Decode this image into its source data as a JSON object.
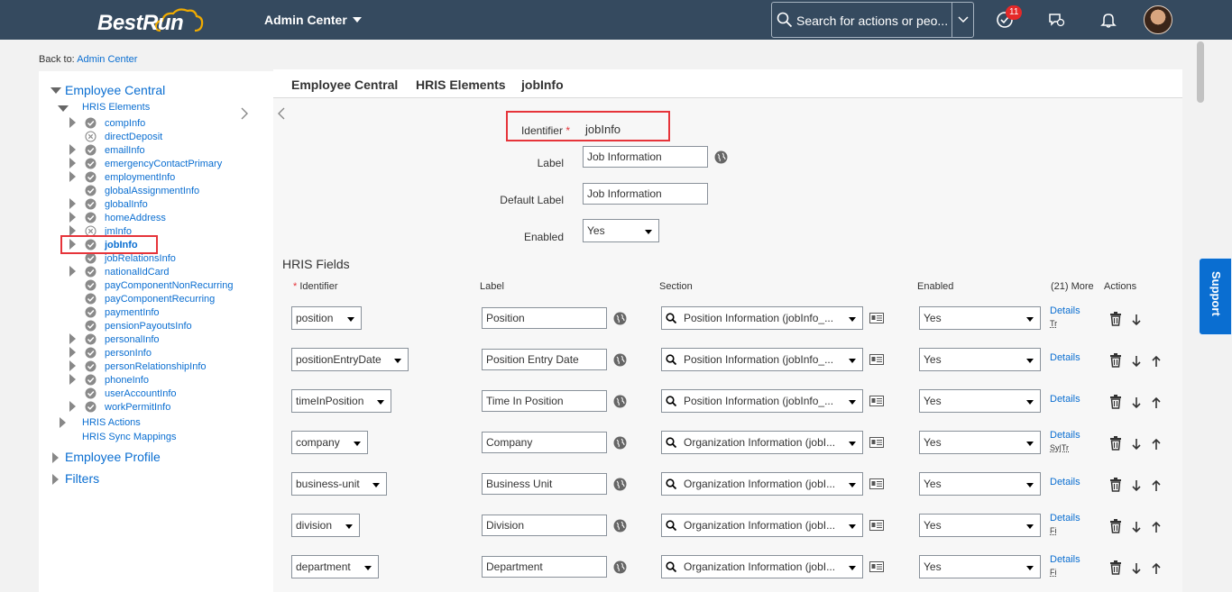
{
  "header": {
    "logo_text": "BestRun",
    "module": "Admin Center",
    "search_placeholder": "Search for actions or peo...",
    "notification_count": "11"
  },
  "back": {
    "prefix": "Back to:",
    "link": "Admin Center"
  },
  "tree": {
    "root": "Employee Central",
    "hris_elements": "HRIS Elements",
    "items": [
      {
        "label": "compInfo",
        "expand": true,
        "status": "check"
      },
      {
        "label": "directDeposit",
        "expand": false,
        "status": "x"
      },
      {
        "label": "emailInfo",
        "expand": true,
        "status": "check"
      },
      {
        "label": "emergencyContactPrimary",
        "expand": true,
        "status": "check"
      },
      {
        "label": "employmentInfo",
        "expand": true,
        "status": "check"
      },
      {
        "label": "globalAssignmentInfo",
        "expand": false,
        "status": "check"
      },
      {
        "label": "globalInfo",
        "expand": true,
        "status": "check"
      },
      {
        "label": "homeAddress",
        "expand": true,
        "status": "check"
      },
      {
        "label": "jmInfo",
        "expand": true,
        "status": "x"
      },
      {
        "label": "jobInfo",
        "expand": true,
        "status": "check"
      },
      {
        "label": "jobRelationsInfo",
        "expand": false,
        "status": "check"
      },
      {
        "label": "nationalIdCard",
        "expand": true,
        "status": "check"
      },
      {
        "label": "payComponentNonRecurring",
        "expand": false,
        "status": "check"
      },
      {
        "label": "payComponentRecurring",
        "expand": false,
        "status": "check"
      },
      {
        "label": "paymentInfo",
        "expand": false,
        "status": "check"
      },
      {
        "label": "pensionPayoutsInfo",
        "expand": false,
        "status": "check"
      },
      {
        "label": "personalInfo",
        "expand": true,
        "status": "check"
      },
      {
        "label": "personInfo",
        "expand": true,
        "status": "check"
      },
      {
        "label": "personRelationshipInfo",
        "expand": true,
        "status": "check"
      },
      {
        "label": "phoneInfo",
        "expand": true,
        "status": "check"
      },
      {
        "label": "userAccountInfo",
        "expand": false,
        "status": "check"
      },
      {
        "label": "workPermitInfo",
        "expand": true,
        "status": "check"
      }
    ],
    "hris_actions": "HRIS Actions",
    "hris_sync": "HRIS Sync Mappings",
    "employee_profile": "Employee Profile",
    "filters": "Filters"
  },
  "breadcrumb": [
    "Employee Central",
    "HRIS Elements",
    "jobInfo"
  ],
  "form": {
    "identifier_label": "Identifier",
    "identifier_value": "jobInfo",
    "label_label": "Label",
    "label_value": "Job Information",
    "default_label_label": "Default Label",
    "default_label_value": "Job Information",
    "enabled_label": "Enabled",
    "enabled_value": "Yes"
  },
  "fields": {
    "title": "HRIS Fields",
    "columns": {
      "identifier": "Identifier",
      "label": "Label",
      "section": "Section",
      "enabled": "Enabled",
      "more": "(21) More",
      "actions": "Actions"
    },
    "rows": [
      {
        "id": "position",
        "label": "Position",
        "section": "Position Information (jobInfo_...",
        "enabled": "Yes",
        "details": "Details",
        "tag": "Tr",
        "up": false
      },
      {
        "id": "positionEntryDate",
        "label": "Position Entry Date",
        "section": "Position Information (jobInfo_...",
        "enabled": "Yes",
        "details": "Details",
        "tag": "",
        "up": true
      },
      {
        "id": "timeInPosition",
        "label": "Time In Position",
        "section": "Position Information (jobInfo_...",
        "enabled": "Yes",
        "details": "Details",
        "tag": "",
        "up": true
      },
      {
        "id": "company",
        "label": "Company",
        "section": "Organization Information (jobI...",
        "enabled": "Yes",
        "details": "Details",
        "tag": "Sy|Tr",
        "up": true
      },
      {
        "id": "business-unit",
        "label": "Business Unit",
        "section": "Organization Information (jobI...",
        "enabled": "Yes",
        "details": "Details",
        "tag": "",
        "up": true
      },
      {
        "id": "division",
        "label": "Division",
        "section": "Organization Information (jobI...",
        "enabled": "Yes",
        "details": "Details",
        "tag": "Fi",
        "up": true
      },
      {
        "id": "department",
        "label": "Department",
        "section": "Organization Information (jobI...",
        "enabled": "Yes",
        "details": "Details",
        "tag": "Fi",
        "up": true
      }
    ]
  },
  "support": "Support"
}
